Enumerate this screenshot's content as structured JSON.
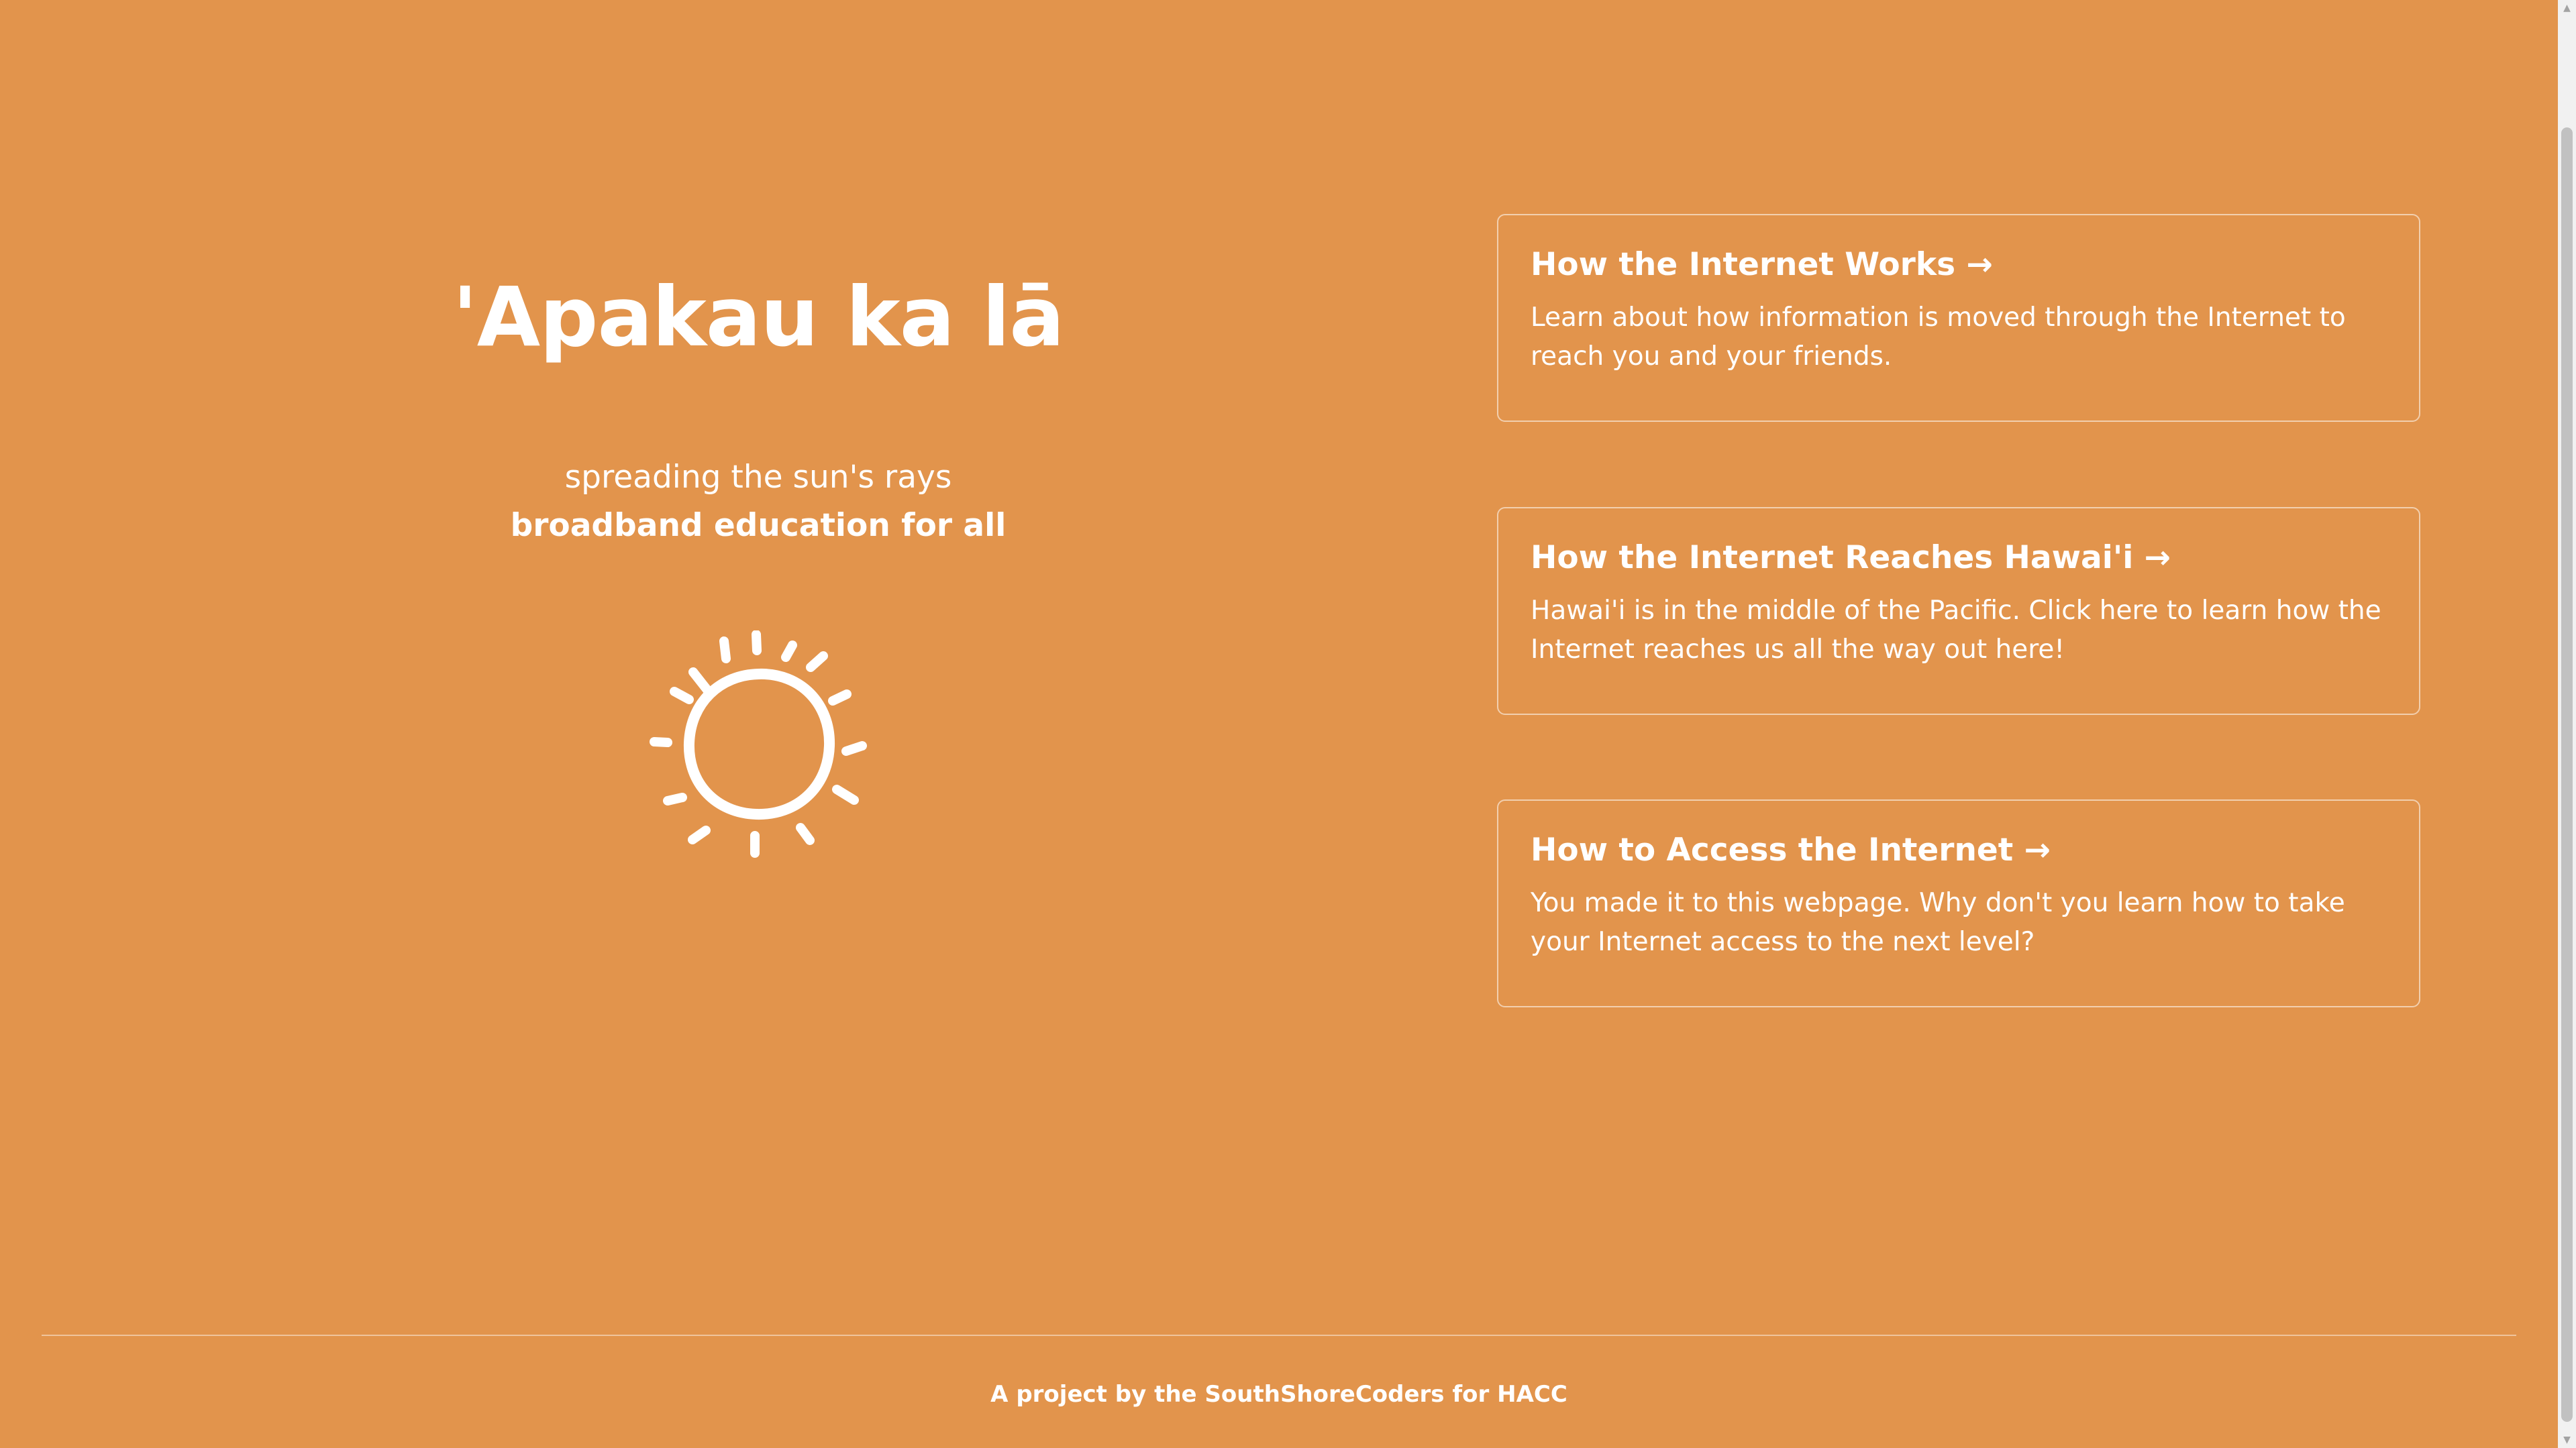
{
  "hero": {
    "title": "'Apakau ka lā",
    "tagline_line1": "spreading the sun's rays",
    "tagline_line2": "broadband education for all",
    "logo_icon": "sun-icon"
  },
  "cards": [
    {
      "title": "How the Internet Works →",
      "description": "Learn about how information is moved through the Internet to reach you and your friends."
    },
    {
      "title": "How the Internet Reaches Hawai'i →",
      "description": "Hawai'i is in the middle of the Pacific. Click here to learn how the Internet reaches us all the way out here!"
    },
    {
      "title": "How to Access the Internet →",
      "description": "You made it to this webpage. Why don't you learn how to take your Internet access to the next level?"
    }
  ],
  "footer": {
    "text": "A project by the SouthShoreCoders for HACC"
  },
  "colors": {
    "background": "#e2944c",
    "foreground": "#ffffff"
  }
}
